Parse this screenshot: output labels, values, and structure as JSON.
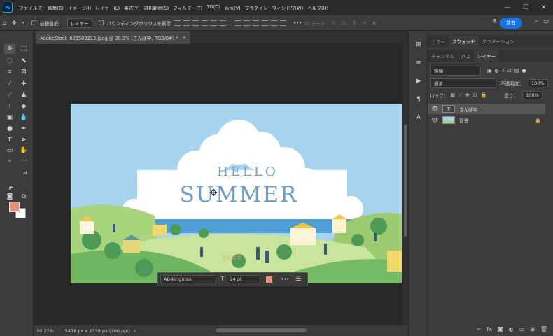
{
  "app": {
    "logo": "Ps"
  },
  "menus": [
    "ファイル(F)",
    "編集(E)",
    "イメージ(I)",
    "レイヤー(L)",
    "書式(Y)",
    "選択範囲(S)",
    "フィルター(T)",
    "3D(D)",
    "表示(V)",
    "プラグイン",
    "ウィンドウ(W)",
    "ヘルプ(H)"
  ],
  "window_controls": {
    "minimize": "—",
    "maximize": "☐",
    "close": "✕"
  },
  "options": {
    "auto_select_label": "自動選択：",
    "auto_select_value": "レイヤー",
    "bounding_box_label": "バウンディングボックスを表示",
    "mode_3d": "3D モード :",
    "more": "•••",
    "share": "共有"
  },
  "document": {
    "tab_title": "AdobeStock_605589213.jpeg @ 30.3% (さんぽ中, RGB/8#) *",
    "close": "×",
    "zoom": "30.27%",
    "dimensions": "5478 px x 2738 px (300 ppi)",
    "image_text_1": "HELLO",
    "image_text_2": "SUMMER",
    "image_text_3": "さんぽ中"
  },
  "context_bar": {
    "font": "AB-kirigirisu",
    "size": "24 pt",
    "more": "•••",
    "color": "#e7927a"
  },
  "panels": {
    "top_tabs": [
      {
        "label": "カラー",
        "active": false
      },
      {
        "label": "スウォッチ",
        "active": true
      },
      {
        "label": "グラデーション",
        "active": false
      }
    ],
    "layer_tabs": [
      {
        "label": "チャンネル",
        "active": false
      },
      {
        "label": "パス",
        "active": false
      },
      {
        "label": "レイヤー",
        "active": true
      }
    ],
    "filter_kind": "種類",
    "blend_mode": "通常",
    "opacity_label": "不透明度：",
    "opacity_value": "100%",
    "lock_label": "ロック：",
    "fill_label": "塗り：",
    "fill_value": "100%",
    "layers": [
      {
        "name": "さんぽ中",
        "kind": "text",
        "thumb": "T",
        "selected": true
      },
      {
        "name": "背景",
        "kind": "image",
        "selected": false,
        "locked": true
      }
    ]
  },
  "colors": {
    "foreground": "#e7927a",
    "background": "#ffffff",
    "accent": "#1473e6"
  }
}
